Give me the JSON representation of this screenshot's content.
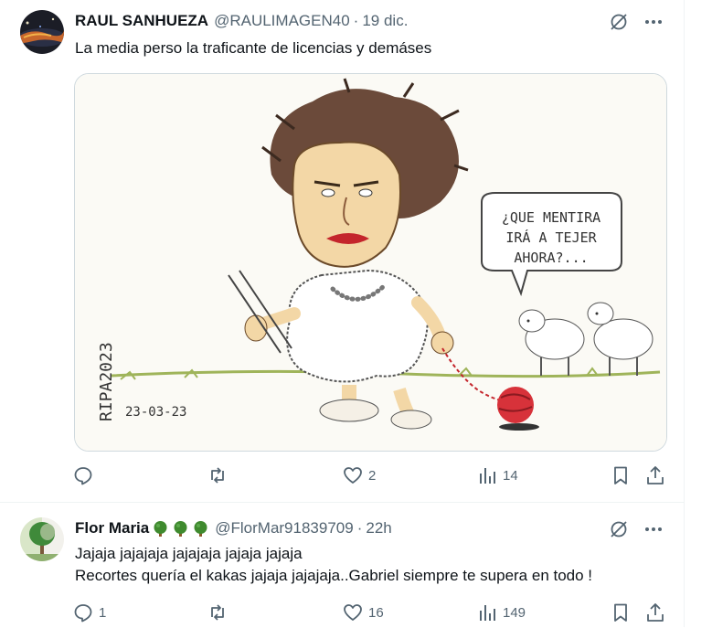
{
  "tweets": [
    {
      "author_name": "RAUL SANHUEZA",
      "handle": "@RAULIMAGEN40",
      "time": "19 dic.",
      "lines": [
        "La media perso la traficante de licencias y demáses"
      ],
      "media": {
        "speech_bubble": [
          "¿QUE MENTIRA",
          "IRÁ A TEJER",
          "AHORA?..."
        ],
        "signature": "RIPA2023",
        "date": "23-03-23"
      },
      "counts": {
        "replies": "",
        "reposts": "",
        "likes": "2",
        "views": "14"
      }
    },
    {
      "author_name": "Flor Maria",
      "handle": "@FlorMar91839709",
      "time": "22h",
      "emoji": [
        "tree-icon",
        "tree-icon",
        "tree-icon"
      ],
      "lines": [
        "Jajaja jajajaja jajajaja jajaja jajaja",
        "Recortes quería el kakas jajaja jajajaja..Gabriel siempre te supera en todo !"
      ],
      "counts": {
        "replies": "1",
        "reposts": "",
        "likes": "16",
        "views": "149"
      }
    }
  ],
  "separator": "·",
  "colors": {
    "text": "#0f1419",
    "muted": "#536471",
    "border": "#cfd9de"
  }
}
